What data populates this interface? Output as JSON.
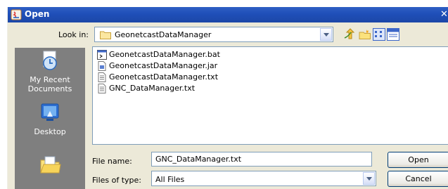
{
  "window": {
    "title": "Open"
  },
  "look_in": {
    "label": "Look in:",
    "value": "GeonetcastDataManager"
  },
  "toolbar": {
    "icons": [
      "up-one-level-icon",
      "create-new-folder-icon",
      "list-view-icon",
      "details-view-icon"
    ]
  },
  "places": [
    {
      "label": "My Recent Documents",
      "icon": "my-recent-documents-icon"
    },
    {
      "label": "Desktop",
      "icon": "desktop-icon"
    },
    {
      "label": "",
      "icon": "my-documents-icon"
    }
  ],
  "files": [
    {
      "name": "GeonetcastDataManager.bat",
      "icon": "batch-file-icon"
    },
    {
      "name": "GeonetcastDataManager.jar",
      "icon": "jar-file-icon"
    },
    {
      "name": "GeonetcastDataManager.txt",
      "icon": "text-file-icon"
    },
    {
      "name": "GNC_DataManager.txt",
      "icon": "text-file-icon"
    }
  ],
  "file_name": {
    "label": "File name:",
    "value": "GNC_DataManager.txt"
  },
  "file_type": {
    "label": "Files of type:",
    "value": "All Files"
  },
  "buttons": {
    "open": "Open",
    "cancel": "Cancel"
  },
  "colors": {
    "titlebar": "#1f4fb8",
    "dialog_bg": "#ece9d8",
    "places_bg": "#7f7f7f",
    "field_border": "#7f9db9"
  }
}
